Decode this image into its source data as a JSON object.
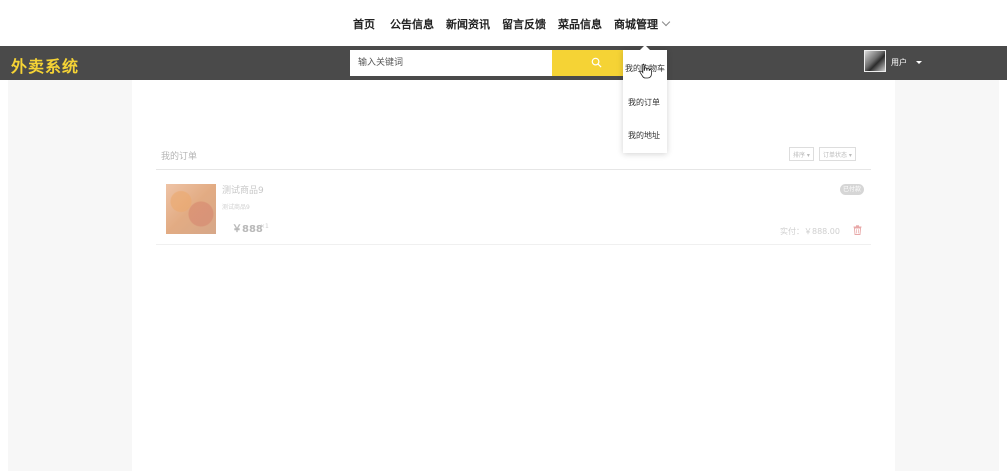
{
  "nav": {
    "items": [
      "首页",
      "公告信息",
      "新闻资讯",
      "留言反馈",
      "菜品信息",
      "商城管理"
    ]
  },
  "header": {
    "brand": "外卖系统",
    "search_placeholder": "输入关键词",
    "user_label": "用户"
  },
  "dropdown": {
    "items": [
      "我的购物车",
      "我的订单",
      "我的地址"
    ]
  },
  "orders": {
    "title": "我的订单",
    "sort_label": "排序",
    "status_filter_label": "订单状态",
    "items": [
      {
        "name": "测试商品9",
        "subtitle": "测试商品9",
        "price": "￥888",
        "qty": "×1",
        "status": "已付款",
        "total": "实付：￥888.00"
      }
    ]
  },
  "colors": {
    "accent": "#f5d335",
    "header_bg": "#4a4a4a",
    "delete_icon": "#e8a8a8"
  },
  "icons": {
    "search": "search-icon",
    "delete": "trash-icon",
    "nav_expand": "chevron-down-icon",
    "user_caret": "caret-down-icon"
  }
}
